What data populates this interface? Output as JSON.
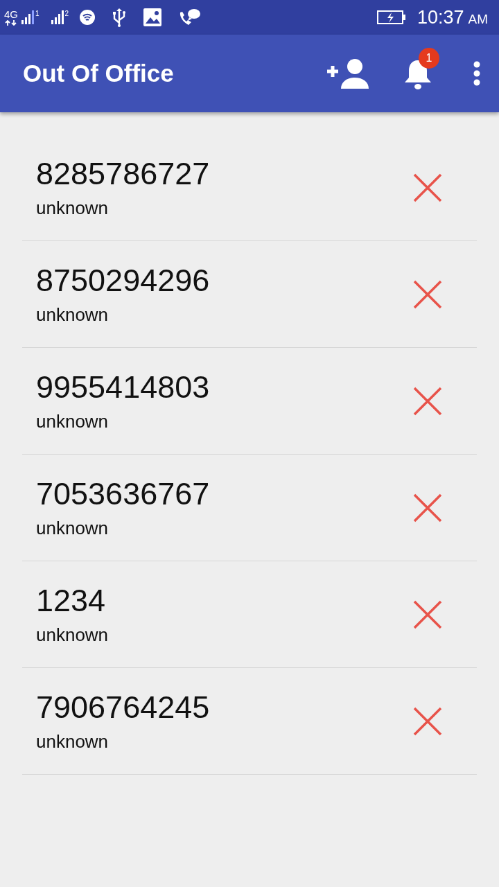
{
  "status_bar": {
    "network": "4G",
    "sim_1": "1",
    "sim_2": "2",
    "time": "10:37",
    "time_suffix": "AM"
  },
  "app_bar": {
    "title": "Out Of Office",
    "notification_count": "1"
  },
  "contacts": [
    {
      "number": "8285786727",
      "name": "unknown"
    },
    {
      "number": "8750294296",
      "name": "unknown"
    },
    {
      "number": "9955414803",
      "name": "unknown"
    },
    {
      "number": "7053636767",
      "name": "unknown"
    },
    {
      "number": "1234",
      "name": "unknown"
    },
    {
      "number": "7906764245",
      "name": "unknown"
    }
  ]
}
